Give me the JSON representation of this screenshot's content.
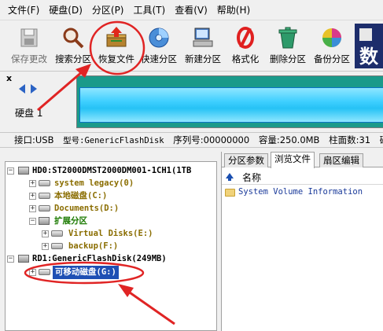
{
  "menu": [
    "文件(F)",
    "硬盘(D)",
    "分区(P)",
    "工具(T)",
    "查看(V)",
    "帮助(H)"
  ],
  "toolbar": {
    "save": "保存更改",
    "search": "搜索分区",
    "recover": "恢复文件",
    "quick": "快速分区",
    "new": "新建分区",
    "format": "格式化",
    "delete": "删除分区",
    "backup": "备份分区",
    "logo_char": "数"
  },
  "disk": {
    "label": "硬盘 1",
    "close": "x",
    "info": {
      "interface": "接口:USB",
      "model": "型号:GenericFlashDisk",
      "serial": "序列号:00000000",
      "capacity": "容量:250.0MB",
      "cylinders": "柱面数:31",
      "heads": "磁头"
    }
  },
  "tree": {
    "hd0": "HD0:ST2000DMST2000DM001-1CH1(1TB",
    "hd0_parts": [
      "system legacy(0)",
      "本地磁盘(C:)",
      "Documents(D:)",
      "扩展分区",
      "Virtual Disks(E:)",
      "backup(F:)"
    ],
    "rd1": "RD1:GenericFlashDisk(249MB)",
    "removable": "可移动磁盘(G:)"
  },
  "right": {
    "tabs": [
      "分区参数",
      "浏览文件",
      "扇区编辑"
    ],
    "active_tab": 1,
    "column_name": "名称",
    "files": [
      "System Volume Information"
    ]
  },
  "colors": {
    "annotation": "#e02424",
    "selection": "#1e4fb4",
    "partition_bar": "#26c2f5"
  }
}
